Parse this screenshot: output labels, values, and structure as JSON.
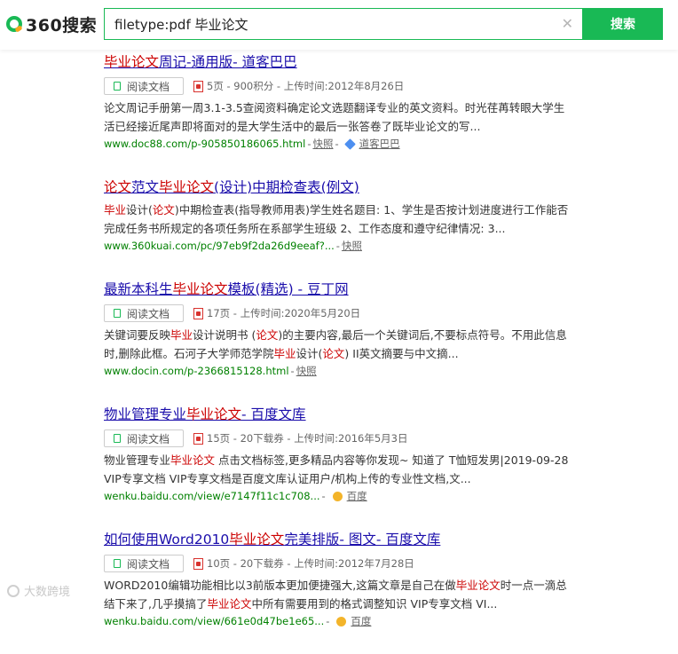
{
  "header": {
    "logo_text": "360搜索",
    "search_value": "filetype:pdf 毕业论文",
    "clear_symbol": "✕",
    "search_button": "搜索"
  },
  "results": [
    {
      "title": [
        {
          "t": "毕业论文",
          "hl": true
        },
        {
          "t": "周记-通用版- 道客巴巴",
          "hl": false
        }
      ],
      "read_label": "阅读文档",
      "has_read_button": true,
      "meta": "5页 - 900积分 - 上传时间:2012年8月26日",
      "snippet": [
        [
          {
            "t": "论文周记手册第一周3.1-3.5查阅资料确定论文选题翻译专业的英文资料。时光荏苒转眼大学生",
            "hl": false
          }
        ],
        [
          {
            "t": "活已经接近尾声即将面对的是大学生活中的最后一张答卷了既毕业论文的写...",
            "hl": false
          }
        ]
      ],
      "url": "www.doc88.com/p-905850186065.html",
      "cache": "快照",
      "site_icon": "diamond",
      "site": "道客巴巴"
    },
    {
      "title": [
        {
          "t": "论文",
          "hl": true
        },
        {
          "t": "范文",
          "hl": false
        },
        {
          "t": "毕业论文",
          "hl": true
        },
        {
          "t": "(设计)中期检查表(例文)",
          "hl": false
        }
      ],
      "has_read_button": false,
      "meta": "",
      "snippet": [
        [
          {
            "t": "毕业",
            "hl": true
          },
          {
            "t": "设计(",
            "hl": false
          },
          {
            "t": "论文",
            "hl": true
          },
          {
            "t": ")中期检查表(指导教师用表)学生姓名题目: 1、学生是否按计划进度进行工作能否",
            "hl": false
          }
        ],
        [
          {
            "t": "完成任务书所规定的各项任务所在系部学生班级 2、工作态度和遵守纪律情况: 3...",
            "hl": false
          }
        ]
      ],
      "url": "www.360kuai.com/pc/97eb9f2da26d9eeaf?...",
      "cache": "快照",
      "site_icon": "",
      "site": ""
    },
    {
      "title": [
        {
          "t": "最新本科生",
          "hl": false
        },
        {
          "t": "毕业论文",
          "hl": true
        },
        {
          "t": "模板(精选) - 豆丁网",
          "hl": false
        }
      ],
      "read_label": "阅读文档",
      "has_read_button": true,
      "meta": "17页 - 上传时间:2020年5月20日",
      "snippet": [
        [
          {
            "t": "关键词要反映",
            "hl": false
          },
          {
            "t": "毕业",
            "hl": true
          },
          {
            "t": "设计说明书 (",
            "hl": false
          },
          {
            "t": "论文",
            "hl": true
          },
          {
            "t": ")的主要内容,最后一个关键词后,不要标点符号。不用此信息",
            "hl": false
          }
        ],
        [
          {
            "t": "时,删除此框。石河子大学师范学院",
            "hl": false
          },
          {
            "t": "毕业",
            "hl": true
          },
          {
            "t": "设计(",
            "hl": false
          },
          {
            "t": "论文",
            "hl": true
          },
          {
            "t": ") II英文摘要与中文摘...",
            "hl": false
          }
        ]
      ],
      "url": "www.docin.com/p-2366815128.html",
      "cache": "快照",
      "site_icon": "",
      "site": ""
    },
    {
      "title": [
        {
          "t": "物业管理专业",
          "hl": false
        },
        {
          "t": "毕业论文",
          "hl": true
        },
        {
          "t": "- 百度文库",
          "hl": false
        }
      ],
      "read_label": "阅读文档",
      "has_read_button": true,
      "meta": "15页 - 20下载券 - 上传时间:2016年5月3日",
      "snippet": [
        [
          {
            "t": "物业管理专业",
            "hl": false
          },
          {
            "t": "毕业论文",
            "hl": true
          },
          {
            "t": " 点击文档标签,更多精品内容等你发现~ 知道了 T恤短发男|2019-09-28",
            "hl": false
          }
        ],
        [
          {
            "t": "VIP专享文档 VIP专享文档是百度文库认证用户/机构上传的专业性文档,文...",
            "hl": false
          }
        ]
      ],
      "url": "wenku.baidu.com/view/e7147f11c1c708...",
      "cache": "",
      "site_icon": "coin",
      "site": "百度"
    },
    {
      "title": [
        {
          "t": "如何使用Word2010",
          "hl": false
        },
        {
          "t": "毕业论文",
          "hl": true
        },
        {
          "t": "完美排版- 图文- 百度文库",
          "hl": false
        }
      ],
      "read_label": "阅读文档",
      "has_read_button": true,
      "meta": "10页 - 20下载券 - 上传时间:2012年7月28日",
      "snippet": [
        [
          {
            "t": "WORD2010编辑功能相比以3前版本更加便捷强大,这篇文章是自己在做",
            "hl": false
          },
          {
            "t": "毕业论文",
            "hl": true
          },
          {
            "t": "时一点一滴总",
            "hl": false
          }
        ],
        [
          {
            "t": "结下来了,几乎摸搞了",
            "hl": false
          },
          {
            "t": "毕业论文",
            "hl": true
          },
          {
            "t": "中所有需要用到的格式调整知识 VIP专享文档 VI...",
            "hl": false
          }
        ]
      ],
      "url": "wenku.baidu.com/view/661e0d47be1e65...",
      "cache": "",
      "site_icon": "coin",
      "site": "百度"
    }
  ],
  "watermark": "大数跨境",
  "colors": {
    "brand_green": "#19b955",
    "title_blue": "#1a0dab",
    "highlight_red": "#cc0000",
    "url_green": "#008000"
  }
}
